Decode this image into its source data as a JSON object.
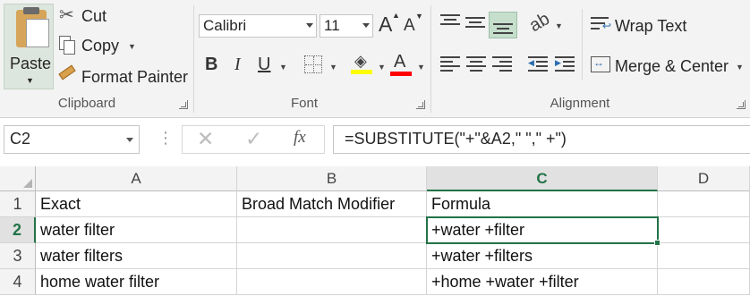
{
  "clipboard": {
    "paste_label": "Paste",
    "cut_label": "Cut",
    "copy_label": "Copy",
    "format_painter_label": "Format Painter",
    "group_label": "Clipboard"
  },
  "font": {
    "font_name": "Calibri",
    "font_size": "11",
    "grow_label": "A",
    "shrink_label": "A",
    "bold_label": "B",
    "italic_label": "I",
    "underline_label": "U",
    "font_color_label": "A",
    "group_label": "Font",
    "colors": {
      "highlight": "#ffff00",
      "font_color": "#ff0000"
    }
  },
  "alignment": {
    "wrap_text_label": "Wrap Text",
    "merge_center_label": "Merge & Center",
    "group_label": "Alignment",
    "active_color": "#c6dfcd"
  },
  "formula_bar": {
    "name_box": "C2",
    "fx_label": "fx",
    "formula": "=SUBSTITUTE(\"+\"&A2,\" \",\" +\")"
  },
  "grid": {
    "columns": [
      "A",
      "B",
      "C",
      "D"
    ],
    "active_column": "C",
    "active_row": "2",
    "active_color": "#217346",
    "rows": [
      {
        "num": "1",
        "cells": [
          "Exact",
          "Broad Match Modifier",
          "Formula",
          ""
        ]
      },
      {
        "num": "2",
        "cells": [
          "water filter",
          "",
          "+water +filter",
          ""
        ]
      },
      {
        "num": "3",
        "cells": [
          "water filters",
          "",
          "+water +filters",
          ""
        ]
      },
      {
        "num": "4",
        "cells": [
          "home water filter",
          "",
          "+home +water +filter",
          ""
        ]
      }
    ]
  }
}
